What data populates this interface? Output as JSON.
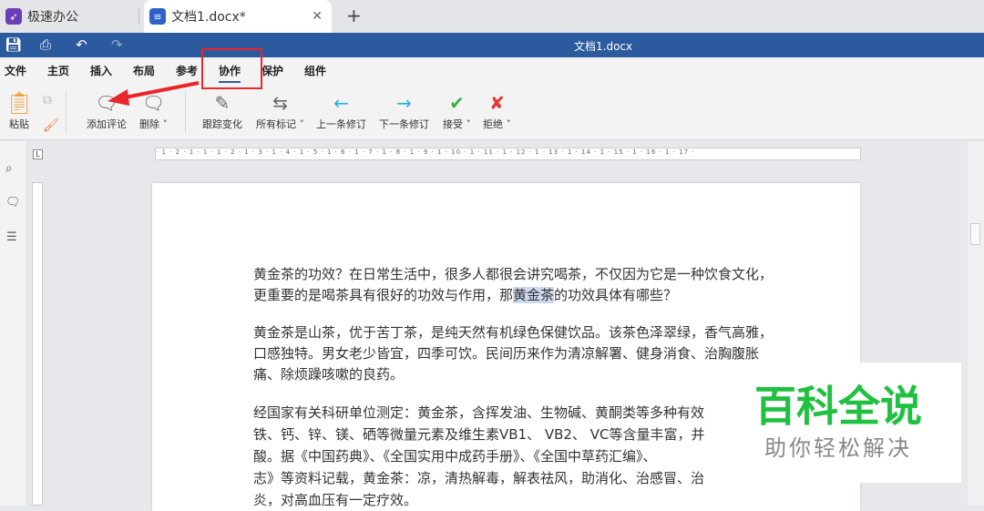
{
  "tabs": [
    {
      "label": "极速办公"
    },
    {
      "label": "文档1.docx*"
    }
  ],
  "title": "文档1.docx",
  "menu": [
    "文件",
    "主页",
    "插入",
    "布局",
    "参考",
    "协作",
    "保护",
    "组件"
  ],
  "active_menu": "协作",
  "toolbar": {
    "paste": "粘贴",
    "add_comment": "添加评论",
    "delete": "删除",
    "track": "跟踪变化",
    "all_marks": "所有标记",
    "prev": "上一条修订",
    "next": "下一条修订",
    "accept": "接受",
    "reject": "拒绝"
  },
  "ruler": "· 1 · 2 · 1 · 1 · 1 · 2 · 1 · 3 · 1 · 4 · 1 · 5 · 1 · 6 · 1 · 7 · 1 · 8 · 1 · 9 · 1 · 10 · 1 · 11 · 1 · 12 · 1 · 13 · 1 · 14 · 1 · 15 · 1 · 16 · 1 · 17 ·",
  "doc": {
    "p1a": "黄金茶的功效？在日常生活中，很多人都很会讲究喝茶，不仅因为它是一种饮食文化，",
    "p1b": "更重要的是喝茶具有很好的功效与作用，那",
    "p1hl": "黄金茶",
    "p1c": "的功效具体有哪些？",
    "p2": [
      "黄金茶是山茶，优于苦丁茶，是纯天然有机绿色保健饮品。该茶色泽翠绿，香气高雅，",
      "口感独特。男女老少皆宜，四季可饮。民间历来作为清凉解署、健身消食、治胸腹胀",
      "痛、除烦躁咳嗽的良药。"
    ],
    "p3": [
      "经国家有关科研单位测定：黄金茶，含挥发油、生物碱、黄酮类等多种有效",
      "铁、钙、锌、镁、硒等微量元素及维生素VB1、 VB2、 VC等含量丰富，并",
      "酸。据《中国药典》、《全国实用中成药手册》、《全国中草药汇编》、",
      "志》等资料记载，黄金茶：凉，清热解毒，解表祛风，助消化、治感冒、治",
      "炎，对高血压有一定疗效。"
    ]
  },
  "watermark": {
    "main": "百科全说",
    "sub": "助你轻松解决"
  }
}
